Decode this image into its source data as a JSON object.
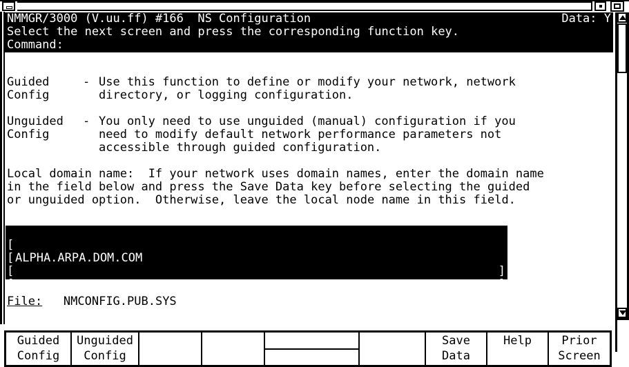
{
  "window": {
    "system_menu_icon": "window-menu-icon",
    "minimize_icon": "minimize-icon",
    "maximize_icon": "maximize-icon",
    "title_field_value": ""
  },
  "header": {
    "title": "NMMGR/3000 (V.uu.ff) #166  NS Configuration",
    "data_indicator": "Data: Y",
    "instruction": "Select the next screen and press the corresponding function key.",
    "command_label": "Command:",
    "command_value": ""
  },
  "body": {
    "sections": [
      {
        "label_line1": "Guided",
        "label_line2": "Config",
        "dash": "-",
        "text_line1": "Use this function to define or modify your network, network",
        "text_line2": "directory, or logging configuration.",
        "text_line3": ""
      },
      {
        "label_line1": "Unguided",
        "label_line2": "Config",
        "dash": "-",
        "text_line1": "You only need to use unguided (manual) configuration if you",
        "text_line2": "need to modify default network performance parameters not",
        "text_line3": "accessible through guided configuration."
      }
    ],
    "paragraph": [
      "Local domain name:  If your network uses domain names, enter the domain name",
      "in the field below and press the Save Data key before selecting the guided",
      "or unguided option.  Otherwise, leave the local node name in this field."
    ]
  },
  "domain_field": {
    "bracket_left": "[",
    "bracket_right": "]",
    "rows": [
      "ALPHA.ARPA.DOM.COM",
      "",
      "",
      ""
    ]
  },
  "file": {
    "label": "File:",
    "value": "NMCONFIG.PUB.SYS"
  },
  "function_keys": [
    {
      "line1": "Guided",
      "line2": "Config",
      "divided": false
    },
    {
      "line1": "Unguided",
      "line2": "Config",
      "divided": false
    },
    {
      "line1": "",
      "line2": "",
      "divided": false
    },
    {
      "line1": "",
      "line2": "",
      "divided": false
    },
    {
      "line1": "",
      "line2": "",
      "divided": true
    },
    {
      "line1": "",
      "line2": "",
      "divided": false
    },
    {
      "line1": "Save",
      "line2": "Data",
      "divided": false
    },
    {
      "line1": "Help",
      "line2": "",
      "divided": false
    },
    {
      "line1": "Prior",
      "line2": "Screen",
      "divided": false
    }
  ],
  "scrollbar": {
    "up_icon": "scroll-up-arrow-icon",
    "down_icon": "scroll-down-arrow-icon",
    "thumb": "scrollbar-thumb"
  },
  "colors": {
    "foreground": "#000000",
    "background": "#ffffff",
    "inverse_fg": "#ffffff",
    "inverse_bg": "#000000"
  }
}
